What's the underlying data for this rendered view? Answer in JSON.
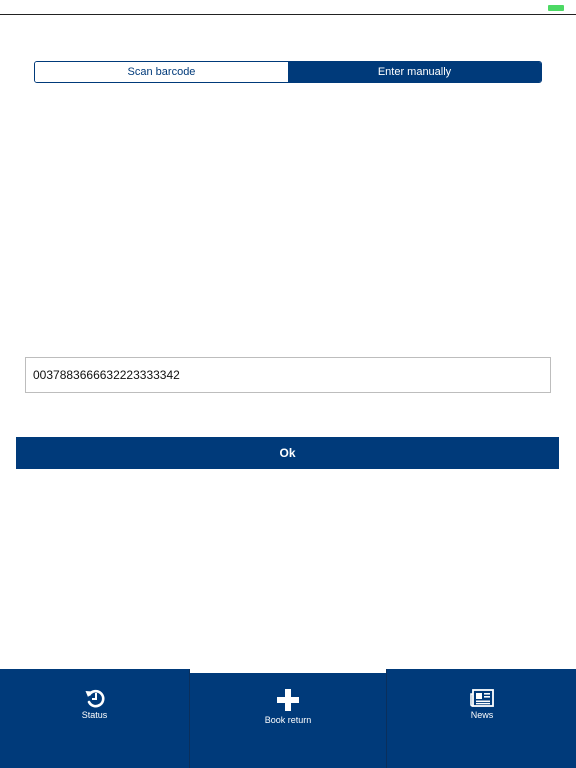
{
  "segmented_control": {
    "options": [
      {
        "label": "Scan barcode",
        "selected": false
      },
      {
        "label": "Enter manually",
        "selected": true
      }
    ]
  },
  "barcode_input": {
    "value": "0037883666632223333342",
    "placeholder": ""
  },
  "ok_button": {
    "label": "Ok"
  },
  "tab_bar": {
    "tabs": [
      {
        "label": "Status",
        "icon": "history-icon",
        "selected": false
      },
      {
        "label": "Book return",
        "icon": "plus-icon",
        "selected": true
      },
      {
        "label": "News",
        "icon": "newspaper-icon",
        "selected": false
      }
    ]
  },
  "colors": {
    "primary": "#003a7a",
    "battery": "#4cd964",
    "background": "#ffffff"
  }
}
